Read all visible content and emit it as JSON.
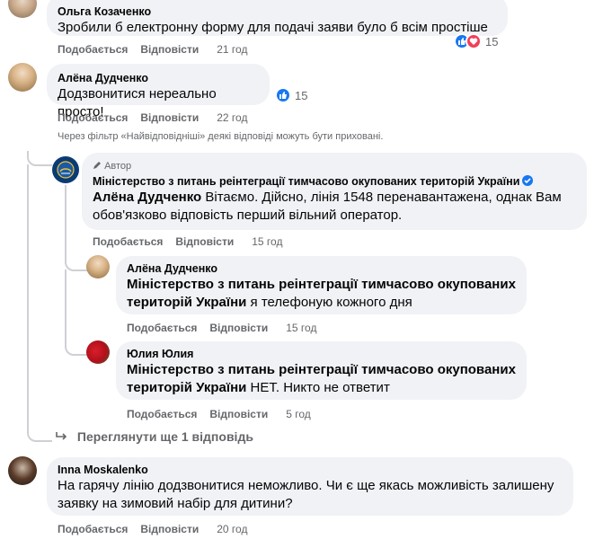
{
  "comments": [
    {
      "author": "Ольга Козаченко",
      "text": "Зробили б електронну форму для подачі заяви було б всім простіше",
      "like": "Подобається",
      "reply": "Відповісти",
      "time": "21 год",
      "reactions": "15"
    },
    {
      "author": "Алёна Дудченко",
      "text": "Додзвонитися нереально просто!",
      "like": "Подобається",
      "reply": "Відповісти",
      "time": "22 год",
      "reactions": "15"
    }
  ],
  "filter_note": "Через фільтр «Найвідповідніші» деякі відповіді можуть бути приховані.",
  "thread": {
    "author_tag": "Автор",
    "author": "Міністерство з питань реінтеграції тимчасово окупованих територій України",
    "mention": "Алёна Дудченко",
    "text": " Вітаємо. Дійсно, лінія 1548 перенавантажена, однак Вам обов'язково відповість перший вільний оператор.",
    "like": "Подобається",
    "reply": "Відповісти",
    "time": "15 год",
    "replies": [
      {
        "author": "Алёна Дудченко",
        "mention": "Міністерство з питань реінтеграції тимчасово окупованих територій України",
        "text": " я телефоную кожного дня",
        "like": "Подобається",
        "reply": "Відповісти",
        "time": "15 год"
      },
      {
        "author": "Юлия Юлия",
        "mention": "Міністерство з питань реінтеграції тимчасово окупованих територій України",
        "text": " НЕТ. Никто не ответит",
        "like": "Подобається",
        "reply": "Відповісти",
        "time": "5 год"
      }
    ],
    "more_replies": "Переглянути ще 1 відповідь"
  },
  "last_comment": {
    "author": "Inna Moskalenko",
    "text": "На гарячу лінію додзвонитися неможливо. Чи є ще якась можливість залишену заявку на зимовий набір для дитини?",
    "like": "Подобається",
    "reply": "Відповісти",
    "time": "20 год"
  },
  "colors": {
    "bubble": "#f0f2f5",
    "meta": "#65676b",
    "like_blue": "#1877f2",
    "love_red": "#f33e58"
  }
}
